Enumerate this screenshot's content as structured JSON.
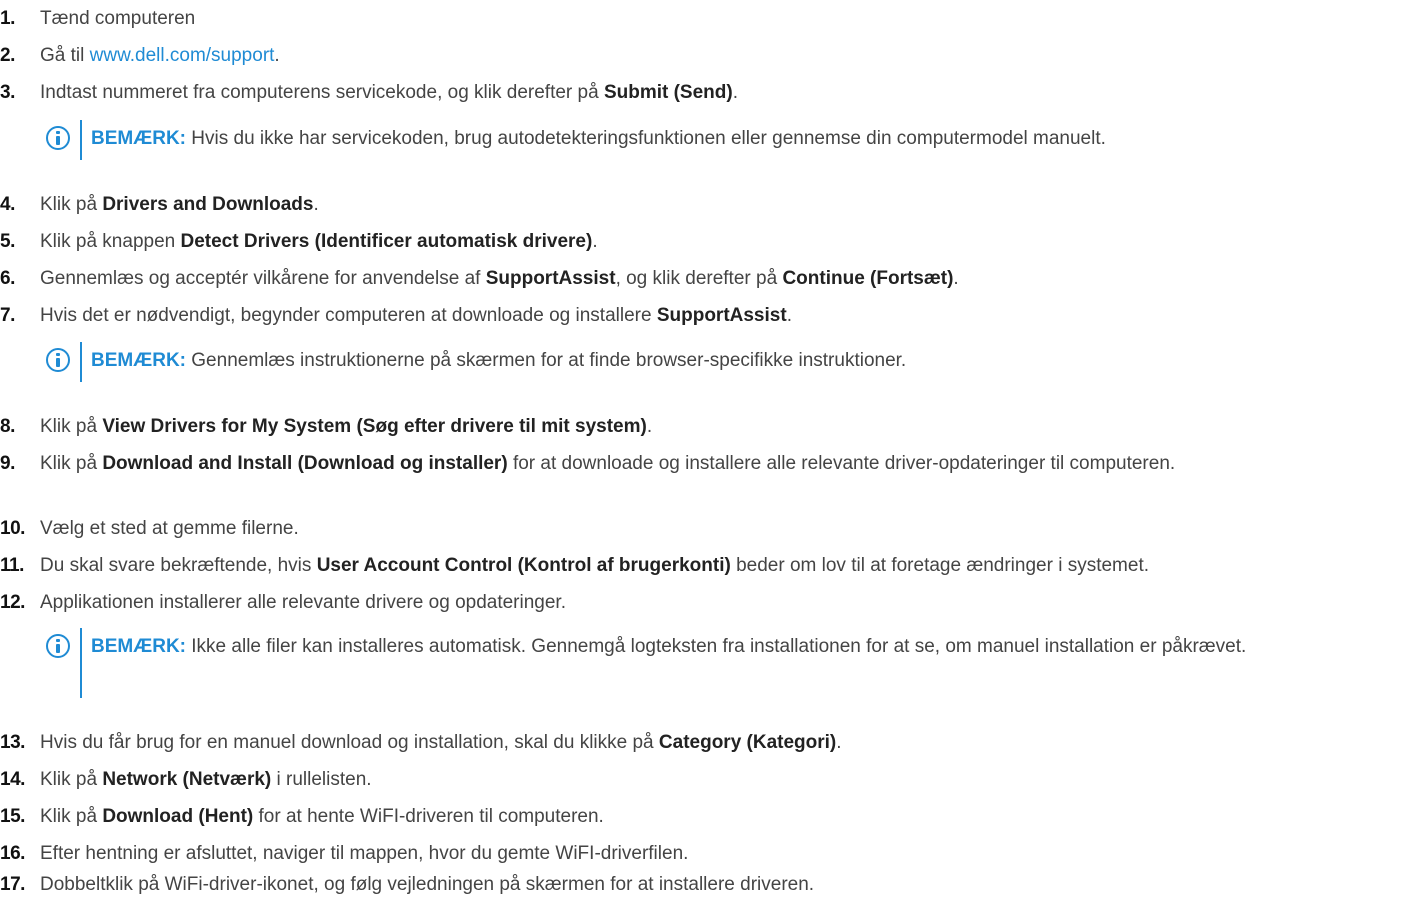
{
  "steps": [
    {
      "num": "1.",
      "text": "Tænd computeren"
    },
    {
      "num": "2.",
      "pre": "Gå til ",
      "link": "www.dell.com/support",
      "post": "."
    },
    {
      "num": "3.",
      "pre": "Indtast nummeret fra computerens servicekode, og klik derefter på ",
      "bold": "Submit (Send)",
      "post": "."
    },
    {
      "num": "4.",
      "pre": "Klik på ",
      "bold": "Drivers and Downloads",
      "post": "."
    },
    {
      "num": "5.",
      "pre": "Klik på knappen ",
      "bold": "Detect Drivers (Identificer automatisk drivere)",
      "post": "."
    },
    {
      "num": "6.",
      "pre": "Gennemlæs og acceptér vilkårene for anvendelse af ",
      "bold": "SupportAssist",
      "mid": ", og klik derefter på ",
      "bold2": "Continue (Fortsæt)",
      "post": "."
    },
    {
      "num": "7.",
      "pre": "Hvis det er nødvendigt, begynder computeren at downloade og installere ",
      "bold": "SupportAssist",
      "post": "."
    },
    {
      "num": "8.",
      "pre": "Klik på ",
      "bold": "View Drivers for My System (Søg efter drivere til mit system)",
      "post": "."
    },
    {
      "num": "9.",
      "pre": "Klik på ",
      "bold": "Download and Install (Download og installer)",
      "post": " for at downloade og installere alle relevante driver-opdateringer til computeren."
    },
    {
      "num": "10.",
      "text": "Vælg et sted at gemme filerne."
    },
    {
      "num": "11.",
      "pre": "Du skal svare bekræftende, hvis ",
      "bold": "User Account Control (Kontrol af brugerkonti)",
      "post": " beder om lov til at foretage ændringer i systemet."
    },
    {
      "num": "12.",
      "text": "Applikationen installerer alle relevante drivere og opdateringer."
    },
    {
      "num": "13.",
      "pre": "Hvis du får brug for en manuel download og installation, skal du klikke på ",
      "bold": "Category (Kategori)",
      "post": "."
    },
    {
      "num": "14.",
      "pre": "Klik på ",
      "bold": "Network (Netværk)",
      "post": " i rullelisten."
    },
    {
      "num": "15.",
      "pre": "Klik på ",
      "bold": "Download (Hent)",
      "post": " for at hente WiFI-driveren til computeren."
    },
    {
      "num": "16.",
      "text": "Efter hentning er afsluttet, naviger til mappen, hvor du gemte WiFI-driverfilen."
    },
    {
      "num": "17.",
      "text": "Dobbeltklik på WiFi-driver-ikonet, og følg vejledningen på skærmen for at installere driveren."
    }
  ],
  "notes": [
    {
      "label": "BEMÆRK:",
      "text": " Hvis du ikke har servicekoden, brug autodetekteringsfunktionen eller gennemse din computermodel manuelt."
    },
    {
      "label": "BEMÆRK:",
      "text": " Gennemlæs instruktionerne på skærmen for at finde browser-specifikke instruktioner."
    },
    {
      "label": "BEMÆRK:",
      "text": " Ikke alle filer kan installeres automatisk. Gennemgå logteksten fra installationen for at se, om manuel installation er påkrævet."
    }
  ]
}
